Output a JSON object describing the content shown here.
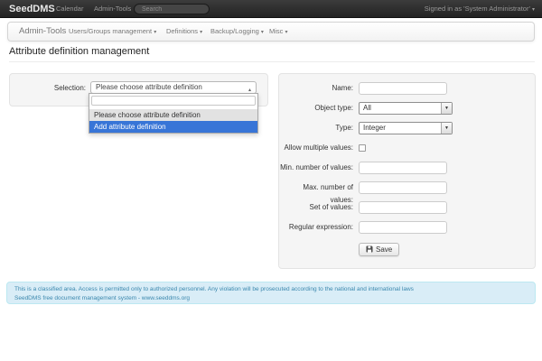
{
  "icons": {
    "caret_down": "▾",
    "caret_up": "▴",
    "select_arrow": "▼"
  },
  "colors": {
    "highlight_blue": "#3875d7",
    "footer_blue": "#3a87ad",
    "well_gray": "#f5f5f5"
  },
  "topnav": {
    "brand": "SeedDMS",
    "items": [
      {
        "label": "Calendar"
      },
      {
        "label": "Admin-Tools"
      }
    ],
    "search_placeholder": "Search",
    "signed_in": "Signed in as 'System Administrator'"
  },
  "subnav": {
    "brand": "Admin-Tools",
    "items": [
      {
        "label": "Users/Groups management"
      },
      {
        "label": "Definitions"
      },
      {
        "label": "Backup/Logging"
      },
      {
        "label": "Misc"
      }
    ]
  },
  "page": {
    "title": "Attribute definition management"
  },
  "selection": {
    "label": "Selection:",
    "selected_value": "Please choose attribute definition",
    "search_value": "",
    "options": [
      {
        "label": "Please choose attribute definition"
      },
      {
        "label": "Add attribute definition"
      }
    ]
  },
  "form": {
    "rows": [
      {
        "label": "Name:",
        "type": "text",
        "value": ""
      },
      {
        "label": "Object type:",
        "type": "select",
        "value": "All"
      },
      {
        "label": "Type:",
        "type": "select",
        "value": "Integer"
      },
      {
        "label": "Allow multiple values:",
        "type": "checkbox",
        "checked": false
      },
      {
        "label": "Min. number of values:",
        "type": "text",
        "value": ""
      },
      {
        "label": "Max. number of values:",
        "type": "text",
        "value": ""
      },
      {
        "label": "Set of values:",
        "type": "text",
        "value": ""
      },
      {
        "label": "Regular expression:",
        "type": "text",
        "value": ""
      }
    ],
    "save_label": "Save"
  },
  "footer": {
    "line1": "This is a classified area. Access is permitted only to authorized personnel. Any violation will be prosecuted according to the national and international laws",
    "line2": "SeedDMS free document management system - www.seeddms.org"
  }
}
